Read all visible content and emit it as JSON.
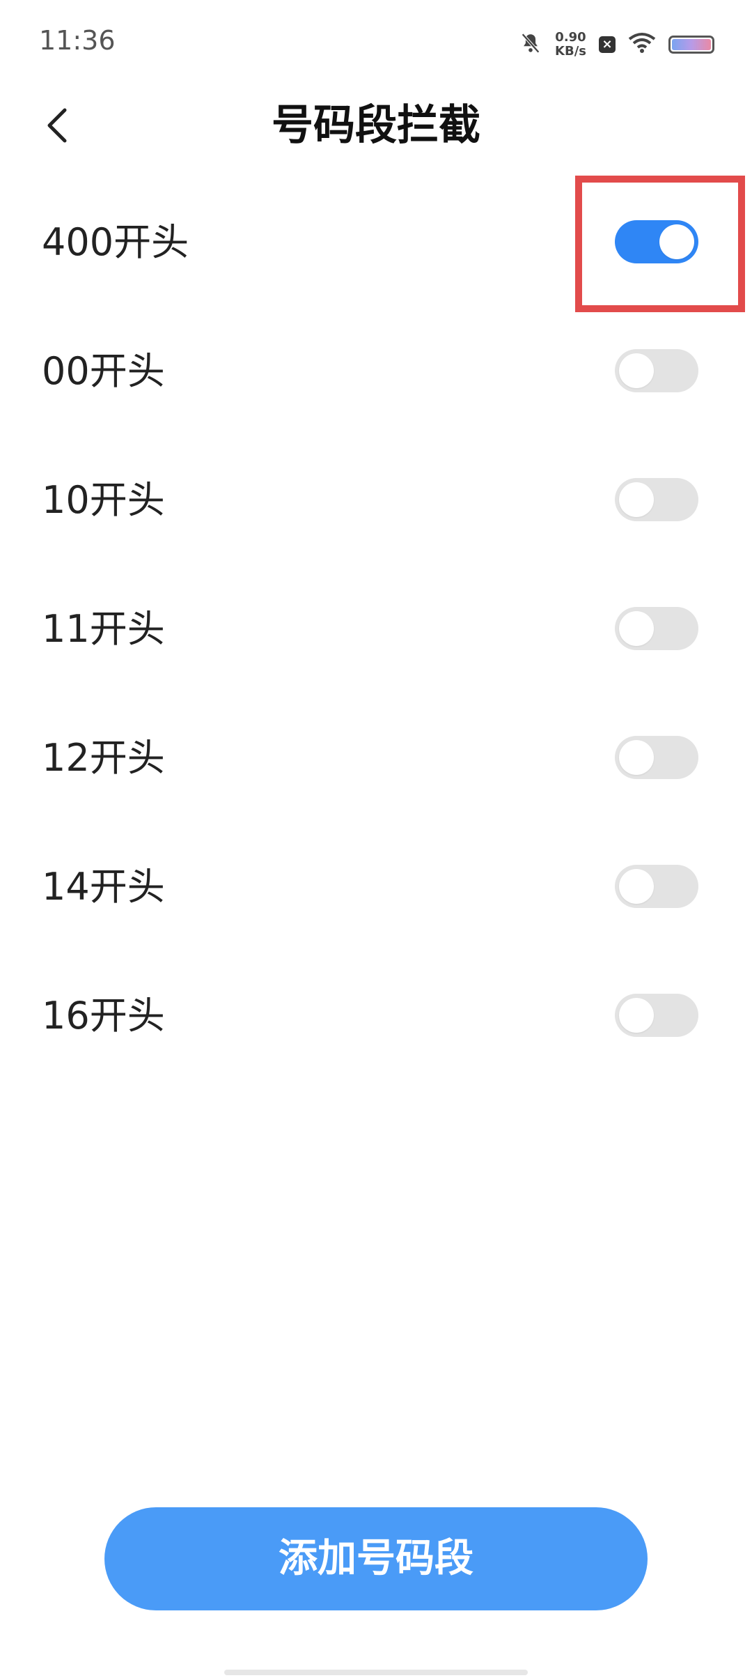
{
  "status_bar": {
    "time": "11:36",
    "net_speed_value": "0.90",
    "net_speed_unit": "KB/s",
    "icons": [
      "bell-off-icon",
      "notification-x-icon",
      "wifi-icon",
      "battery-icon"
    ]
  },
  "header": {
    "back_icon": "chevron-left-icon",
    "title": "号码段拦截"
  },
  "list": {
    "items": [
      {
        "label": "400开头",
        "enabled": true
      },
      {
        "label": "00开头",
        "enabled": false
      },
      {
        "label": "10开头",
        "enabled": false
      },
      {
        "label": "11开头",
        "enabled": false
      },
      {
        "label": "12开头",
        "enabled": false
      },
      {
        "label": "14开头",
        "enabled": false
      },
      {
        "label": "16开头",
        "enabled": false
      }
    ]
  },
  "add_button": {
    "label": "添加号码段"
  },
  "colors": {
    "toggle_on": "#2f86f5",
    "toggle_off": "#e3e3e3",
    "button": "#4a9bf7",
    "highlight": "#e24b4b"
  }
}
